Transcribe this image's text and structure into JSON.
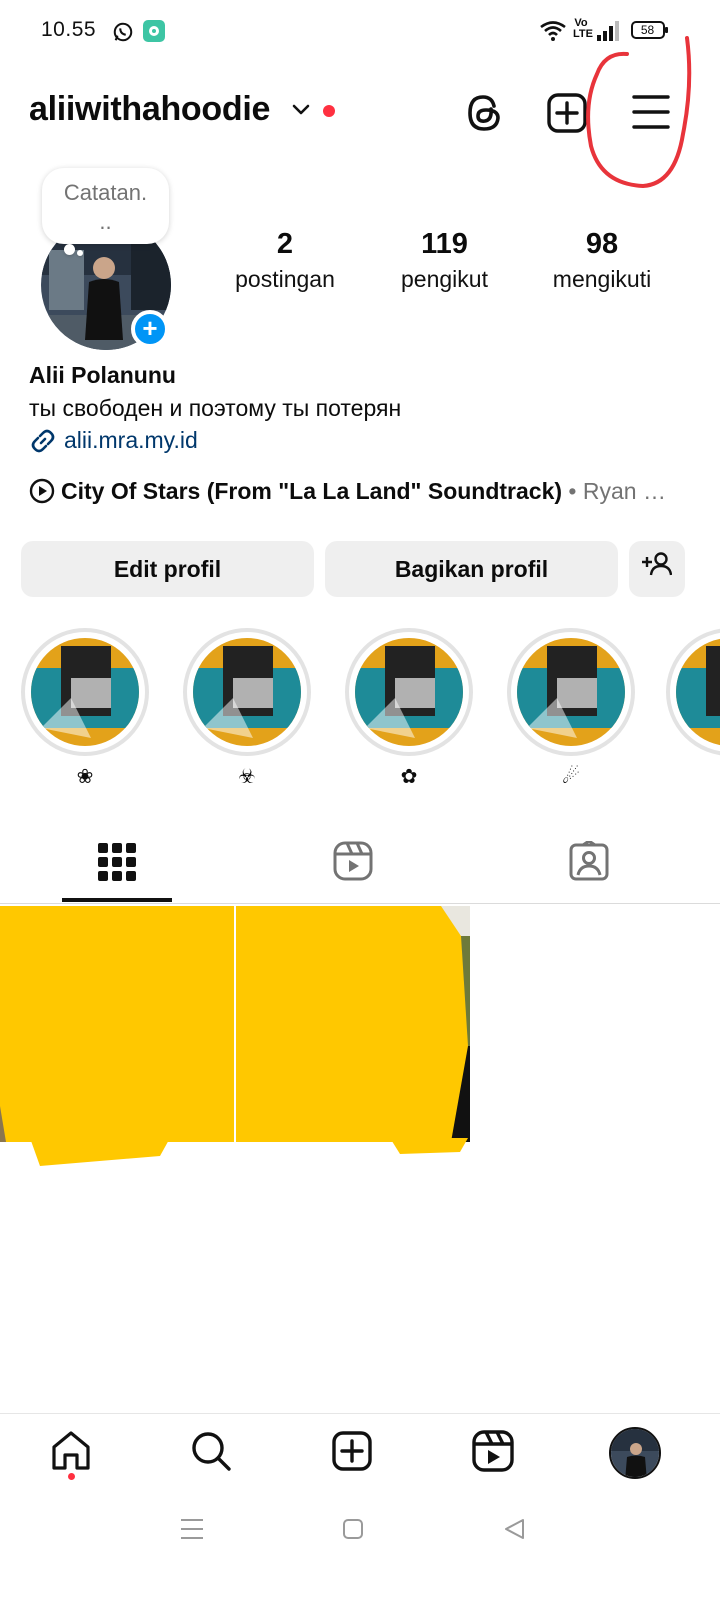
{
  "status_bar": {
    "time": "10.55",
    "battery": "58",
    "signal_label": "Vo LTE"
  },
  "header": {
    "username": "aliiwithahoodie",
    "icons": [
      "chevron-down-icon",
      "threads-icon",
      "add-post-icon",
      "menu-icon"
    ],
    "notification_dot_color": "#ff3040",
    "annotation_color": "#e8343b"
  },
  "profile": {
    "note": "Catatan...",
    "note_line1": "Catatan.",
    "note_line2": "..",
    "stats": [
      {
        "value": "2",
        "label": "postingan"
      },
      {
        "value": "119",
        "label": "pengikut"
      },
      {
        "value": "98",
        "label": "mengikuti"
      }
    ],
    "full_name": "Alii Polanunu",
    "bio": "ты свободен и поэтому ты потерян",
    "link": "alii.mra.my.id",
    "music": {
      "title": "City Of Stars (From \"La La Land\" Soundtrack)",
      "artist": " • Ryan …"
    }
  },
  "actions": {
    "edit_label": "Edit profil",
    "share_label": "Bagikan profil"
  },
  "highlights": [
    {
      "label": "❀"
    },
    {
      "label": "☣"
    },
    {
      "label": "✿"
    },
    {
      "label": "☄"
    }
  ],
  "tabs": [
    "grid-icon",
    "reels-icon",
    "tagged-icon"
  ],
  "bottom_nav": [
    "home-icon",
    "search-icon",
    "create-icon",
    "reels-icon",
    "profile-avatar"
  ],
  "colors": {
    "accent_blue": "#0095f6",
    "link_blue": "#00376b",
    "button_bg": "#efefef",
    "redaction_yellow": "#ffc800"
  }
}
